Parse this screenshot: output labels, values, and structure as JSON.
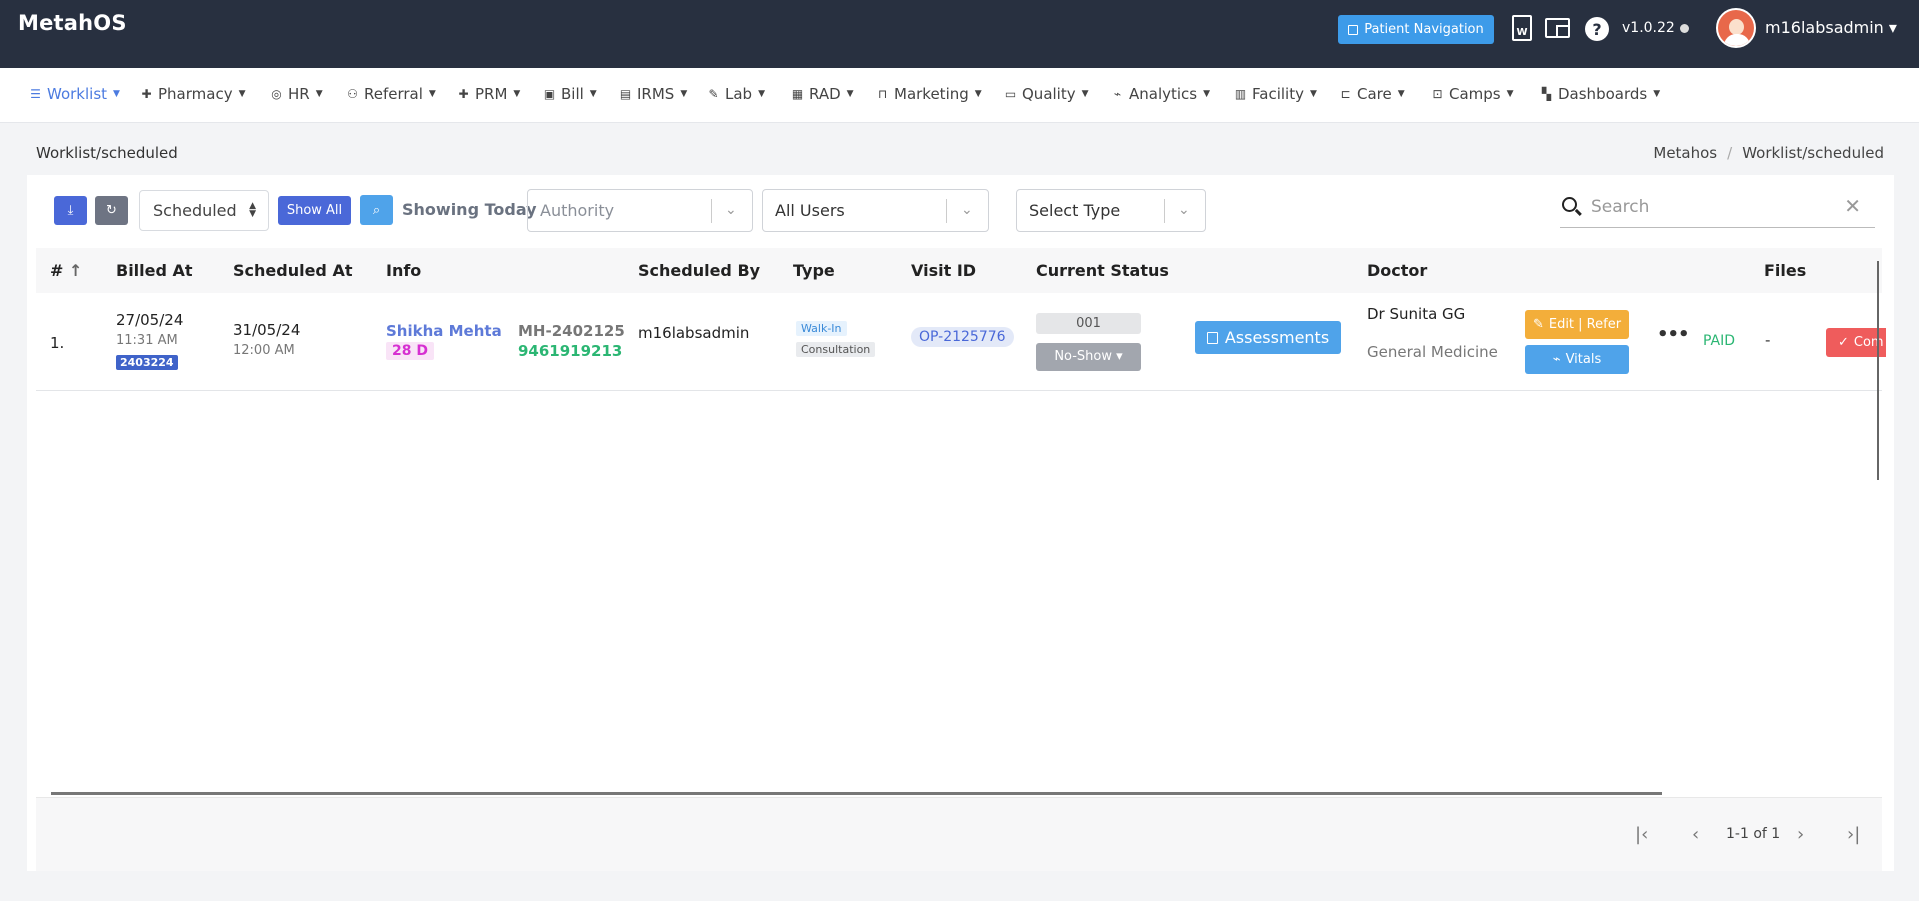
{
  "app": {
    "title": "MetahOS"
  },
  "header": {
    "patient_nav_label": "Patient Navigation",
    "version": "v1.0.22",
    "username": "m16labsadmin",
    "doc_icon_letter": "W"
  },
  "nav": {
    "items": [
      {
        "label": "Worklist",
        "icon": "list-icon"
      },
      {
        "label": "Pharmacy",
        "icon": "plus-icon"
      },
      {
        "label": "HR",
        "icon": "user-circle-icon"
      },
      {
        "label": "Referral",
        "icon": "users-icon"
      },
      {
        "label": "PRM",
        "icon": "plus-icon"
      },
      {
        "label": "Bill",
        "icon": "bill-icon"
      },
      {
        "label": "IRMS",
        "icon": "card-icon"
      },
      {
        "label": "Lab",
        "icon": "pencil-icon"
      },
      {
        "label": "RAD",
        "icon": "film-icon"
      },
      {
        "label": "Marketing",
        "icon": "bag-icon"
      },
      {
        "label": "Quality",
        "icon": "doc-icon"
      },
      {
        "label": "Analytics",
        "icon": "pulse-icon"
      },
      {
        "label": "Facility",
        "icon": "building-icon"
      },
      {
        "label": "Care",
        "icon": "bed-icon"
      },
      {
        "label": "Camps",
        "icon": "briefcase-icon"
      },
      {
        "label": "Dashboards",
        "icon": "grid-icon"
      }
    ]
  },
  "breadcrumb": {
    "page_title": "Worklist/scheduled",
    "root": "Metahos",
    "current": "Worklist/scheduled"
  },
  "toolbar": {
    "status_select": "Scheduled",
    "show_all_label": "Show All",
    "showing_today": "Showing Today",
    "authority_placeholder": "Authority",
    "users_value": "All Users",
    "type_placeholder": "Select Type",
    "search_placeholder": "Search"
  },
  "table": {
    "headers": {
      "num": "#",
      "billed_at": "Billed At",
      "scheduled_at": "Scheduled At",
      "info": "Info",
      "scheduled_by": "Scheduled By",
      "type": "Type",
      "visit_id": "Visit ID",
      "current_status": "Current Status",
      "doctor": "Doctor",
      "files": "Files"
    },
    "rows": [
      {
        "num": "1.",
        "billed_date": "27/05/24",
        "billed_time": "11:31 AM",
        "bill_id": "2403224",
        "scheduled_date": "31/05/24",
        "scheduled_time": "12:00 AM",
        "patient_name": "Shikha Mehta",
        "age": "28 D",
        "mrn": "MH-2402125",
        "phone": "9461919213",
        "scheduled_by": "m16labsadmin",
        "type_tag": "Walk-In",
        "type_sub": "Consultation",
        "visit_id": "OP-2125776",
        "token": "001",
        "status": "No-Show",
        "assessments_label": "Assessments",
        "doctor": "Dr Sunita GG",
        "department": "General Medicine",
        "edit_refer_label": "Edit | Refer",
        "vitals_label": "Vitals",
        "payment": "PAID",
        "files": "-",
        "complete_label": "Com"
      }
    ]
  },
  "pagination": {
    "info": "1-1 of 1"
  },
  "colors": {
    "header_bg": "#283040",
    "primary": "#4a68d8",
    "info": "#4fa3ea",
    "warning": "#f3ae3a",
    "danger": "#ef5c5c",
    "success": "#2bb673"
  }
}
